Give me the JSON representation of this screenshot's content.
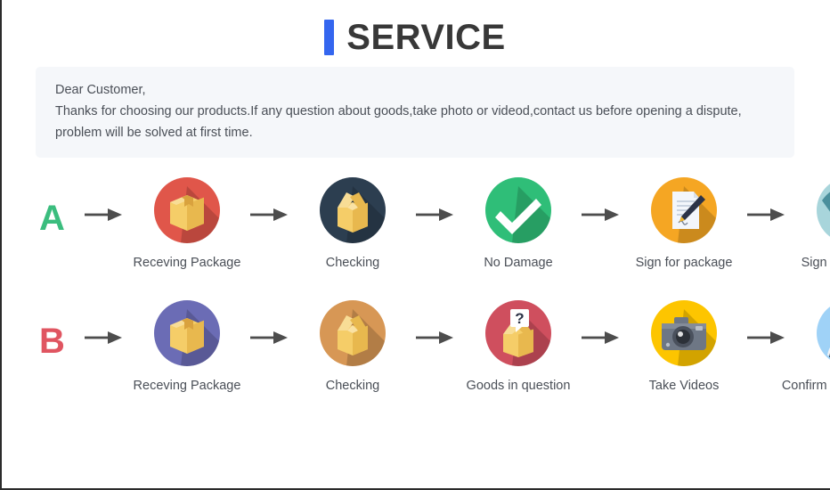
{
  "header": {
    "title": "SERVICE",
    "accent_bar_color": "#3466ef",
    "title_color": "#383838"
  },
  "notice": {
    "line1": "Dear Customer,",
    "line2": "Thanks for choosing our products.If any question about goods,take photo or videod,contact us before opening a dispute,",
    "line3": "problem will be solved at first time.",
    "background_color": "#f5f7fa",
    "text_color": "#4a4f57"
  },
  "flows": [
    {
      "letter": "A",
      "letter_color": "#3bbd7e",
      "steps": [
        {
          "icon": "closed-box-icon",
          "circle_color": "#e0564a",
          "label": "Receving Package"
        },
        {
          "icon": "open-box-icon",
          "circle_color": "#2c3e50",
          "label": "Checking"
        },
        {
          "icon": "check-mark-icon",
          "circle_color": "#2fbe78",
          "label": "No Damage"
        },
        {
          "icon": "document-pen-icon",
          "circle_color": "#f5a623",
          "label": "Sign for package"
        },
        {
          "icon": "handshake-icon",
          "circle_color": "#a8d5db",
          "label": "Sign for package"
        }
      ]
    },
    {
      "letter": "B",
      "letter_color": "#e05561",
      "steps": [
        {
          "icon": "closed-box-icon",
          "circle_color": "#6b6cb5",
          "label": "Receving Package"
        },
        {
          "icon": "open-box-icon",
          "circle_color": "#d79755",
          "label": "Checking"
        },
        {
          "icon": "question-box-icon",
          "circle_color": "#cf4f5e",
          "label": "Goods in question"
        },
        {
          "icon": "camera-icon",
          "circle_color": "#fdc500",
          "label": "Take Videos"
        },
        {
          "icon": "person-icon",
          "circle_color": "#9fd2f7",
          "label": "Confirm problem,refund money"
        }
      ]
    }
  ],
  "arrow": {
    "name": "arrow-right-icon",
    "color": "#4d4d4d"
  }
}
